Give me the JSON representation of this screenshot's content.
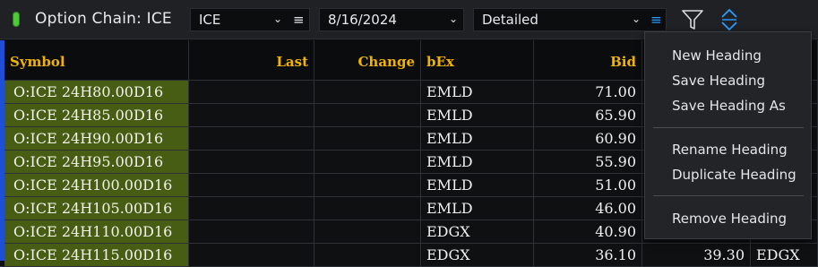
{
  "window": {
    "title": "Option Chain: ICE",
    "status_color": "#4ec93a"
  },
  "toolbar": {
    "symbol_select": "ICE",
    "date_select": "8/16/2024",
    "view_select": "Detailed",
    "filter_icon": "filter-funnel-icon",
    "sort_icon": "sort-up-down-icon",
    "accent_color": "#2b9cff"
  },
  "table": {
    "columns": [
      "Symbol",
      "Last",
      "Change",
      "bEx",
      "Bid",
      "",
      ""
    ],
    "rows": [
      {
        "symbol": "O:ICE 24H80.00D16",
        "last": "",
        "change": "",
        "bex": "EMLD",
        "bid": "71.00",
        "ask": "",
        "aex": ""
      },
      {
        "symbol": "O:ICE 24H85.00D16",
        "last": "",
        "change": "",
        "bex": "EMLD",
        "bid": "65.90",
        "ask": "",
        "aex": ""
      },
      {
        "symbol": "O:ICE 24H90.00D16",
        "last": "",
        "change": "",
        "bex": "EMLD",
        "bid": "60.90",
        "ask": "",
        "aex": ""
      },
      {
        "symbol": "O:ICE 24H95.00D16",
        "last": "",
        "change": "",
        "bex": "EMLD",
        "bid": "55.90",
        "ask": "",
        "aex": ""
      },
      {
        "symbol": "O:ICE 24H100.00D16",
        "last": "",
        "change": "",
        "bex": "EMLD",
        "bid": "51.00",
        "ask": "",
        "aex": ""
      },
      {
        "symbol": "O:ICE 24H105.00D16",
        "last": "",
        "change": "",
        "bex": "EMLD",
        "bid": "46.00",
        "ask": "",
        "aex": ""
      },
      {
        "symbol": "O:ICE 24H110.00D16",
        "last": "",
        "change": "",
        "bex": "EDGX",
        "bid": "40.90",
        "ask": "",
        "aex": ""
      },
      {
        "symbol": "O:ICE 24H115.00D16",
        "last": "",
        "change": "",
        "bex": "EDGX",
        "bid": "36.10",
        "ask": "39.30",
        "aex": "EDGX"
      }
    ],
    "header_color": "#f0b400",
    "symbol_bg": "#465d13"
  },
  "menu": {
    "items": [
      "New Heading",
      "Save Heading",
      "Save Heading As",
      "Rename Heading",
      "Duplicate Heading",
      "Remove Heading"
    ]
  }
}
